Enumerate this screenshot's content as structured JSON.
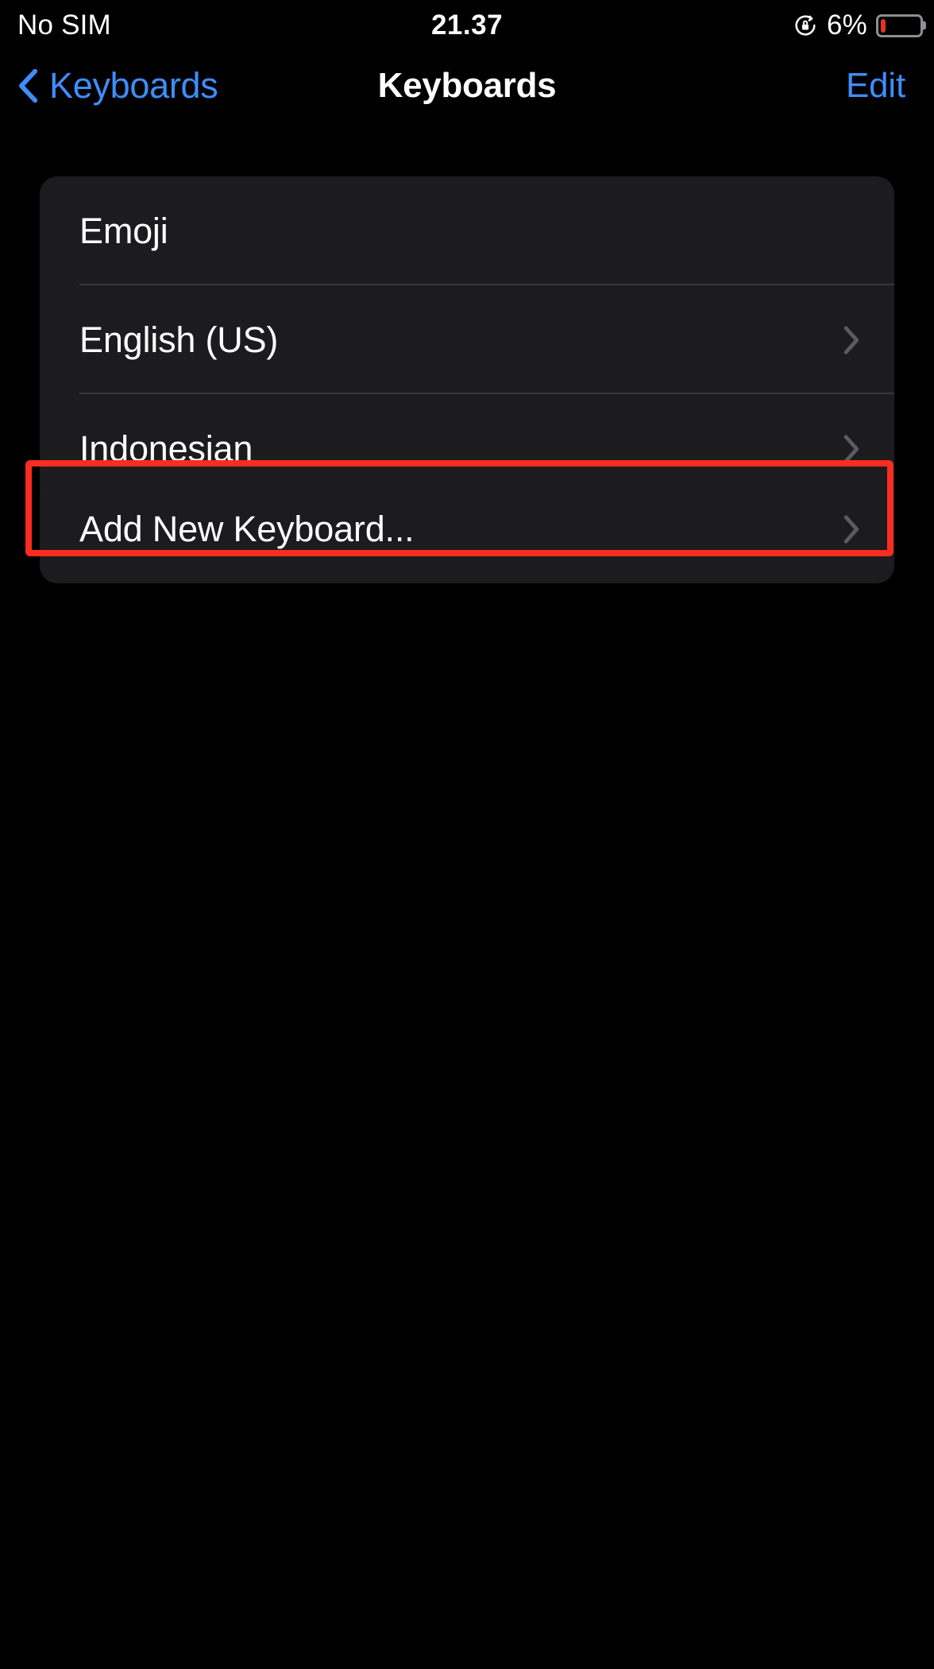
{
  "status_bar": {
    "carrier": "No SIM",
    "time": "21.37",
    "battery_percent": "6%",
    "rotation_lock_icon": "rotation-lock-icon",
    "battery_icon": "battery-low-icon",
    "battery_level": 6,
    "battery_fill_color": "#e63127"
  },
  "nav_bar": {
    "back_label": "Keyboards",
    "back_icon": "chevron-left-icon",
    "title": "Keyboards",
    "edit_label": "Edit",
    "accent_color": "#3f8dfb"
  },
  "sections": [
    {
      "id": "keyboards-list",
      "rows": [
        {
          "label": "Emoji",
          "chevron": false
        },
        {
          "label": "English (US)",
          "chevron": true
        },
        {
          "label": "Indonesian",
          "chevron": true
        }
      ]
    },
    {
      "id": "add-keyboard",
      "rows": [
        {
          "label": "Add New Keyboard...",
          "chevron": true
        }
      ]
    }
  ],
  "annotation": {
    "target": "Add New Keyboard...",
    "color": "#fb2c20"
  },
  "theme": {
    "background": "#000000",
    "card_background": "#1c1c1e",
    "separator": "#38383a",
    "primary_text": "#ffffff",
    "chevron": "#5b5b60"
  }
}
